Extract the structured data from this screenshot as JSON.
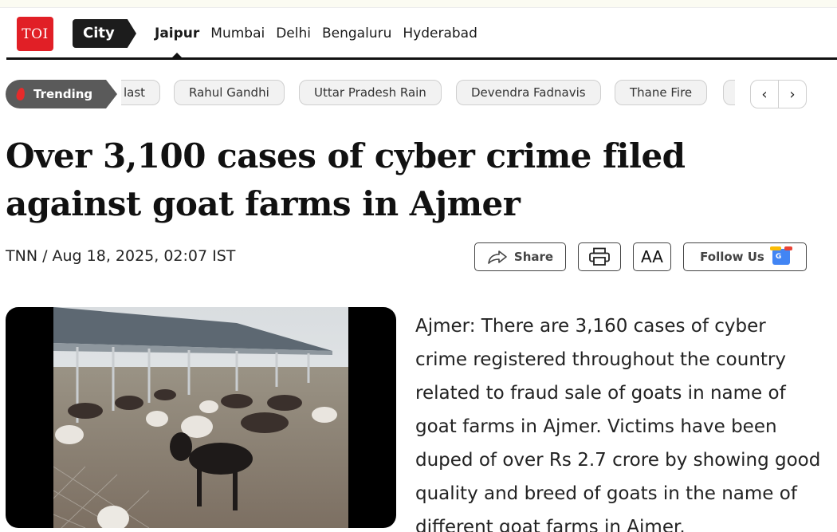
{
  "brand": {
    "logo_text": "TOI",
    "logo_color": "#e11f26"
  },
  "nav": {
    "section_label": "City",
    "cities": [
      "Jaipur",
      "Mumbai",
      "Delhi",
      "Bengaluru",
      "Hyderabad"
    ],
    "active_city": "Jaipur"
  },
  "trending": {
    "label": "Trending",
    "icon": "fire-icon",
    "topics": [
      "last",
      "Rahul Gandhi",
      "Uttar Pradesh Rain",
      "Devendra Fadnavis",
      "Thane Fire"
    ]
  },
  "article": {
    "headline": "Over 3,100 cases of cyber crime filed against goat farms in Ajmer",
    "byline": "TNN / Aug 18, 2025, 02:07 IST",
    "actions": {
      "share_label": "Share",
      "font_size_label": "AA",
      "follow_label": "Follow Us"
    },
    "gnews_badge": "G",
    "body": "Ajmer: There are 3,160 cases of cyber crime registered throughout the country related to fraud sale of goats in name of goat farms in Ajmer. Victims have been duped of over Rs 2.7 crore by showing good quality and breed of goats in the name of different goat farms in Ajmer."
  },
  "icons": {
    "share": "share-arrow-icon",
    "print": "printer-icon",
    "prev": "chevron-left-icon",
    "next": "chevron-right-icon"
  }
}
